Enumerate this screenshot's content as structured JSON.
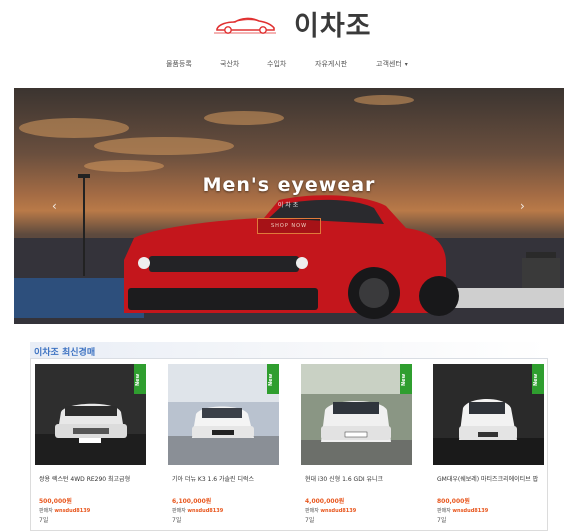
{
  "header": {
    "logo_text": "이차조",
    "logo_icon": "car-icon",
    "logo_color": "#e03131"
  },
  "nav": {
    "items": [
      "물품등록",
      "국산차",
      "수입차",
      "자유게시판",
      "고객센터"
    ],
    "dropdown_icon": "caret-down-icon"
  },
  "hero": {
    "title": "Men's eyewear",
    "subtitle": "이차조",
    "cta": "SHOP NOW",
    "prev_icon": "chevron-left-icon",
    "next_icon": "chevron-right-icon",
    "car_color": "#c4161c"
  },
  "section": {
    "title": "이차조 최신경매",
    "title_color": "#3e73c2"
  },
  "listings": [
    {
      "name": "쌍용 렉스턴 4WD RE290 최고급형",
      "price": "500,000원",
      "seller_label": "판매자",
      "seller": "wnsdud8139",
      "time": "7일",
      "badge": "New",
      "bg": "#3a3a3a",
      "car": "#e8e8e8"
    },
    {
      "name": "기아 더뉴 K3 1.6 가솔린 디럭스",
      "price": "6,100,000원",
      "seller_label": "판매자",
      "seller": "wnsdud8139",
      "time": "7일",
      "badge": "New",
      "bg": "#9aa4b4",
      "car": "#f4f4f4"
    },
    {
      "name": "현대 i30 신형 1.6 GDI 유니크",
      "price": "4,000,000원",
      "seller_label": "판매자",
      "seller": "wnsdud8139",
      "time": "7일",
      "badge": "New",
      "bg": "#7e8a7a",
      "car": "#f0f0f0"
    },
    {
      "name": "GM대우(쉐보레) 마티즈크리에이티브 팝",
      "price": "800,000원",
      "seller_label": "판매자",
      "seller": "wnsdud8139",
      "time": "7일",
      "badge": "New",
      "bg": "#2c2c2c",
      "car": "#f2f2f2"
    }
  ]
}
